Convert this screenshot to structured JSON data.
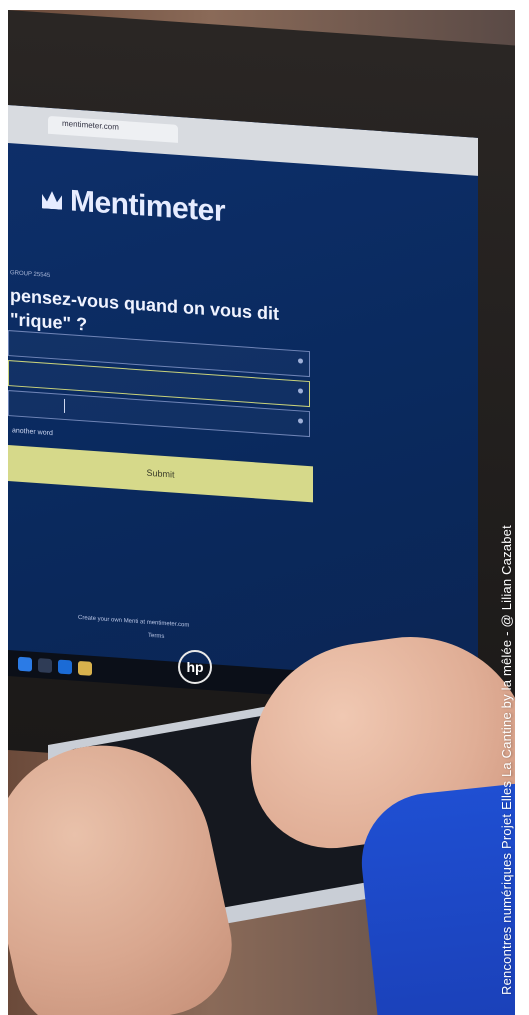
{
  "photo": {
    "browser_tab_label": "mentimeter.com",
    "app_name": "Mentimeter",
    "question_tag": "GROUP 25545",
    "question_text": "pensez-vous quand on vous dit\n\"rique\" ?",
    "input_placeholder": "",
    "add_another_label": "another word",
    "submit_label": "Submit",
    "footer_line_1": "Create your own Menti at mentimeter.com",
    "footer_line_2": "Terms",
    "brand_logo": "hp"
  },
  "credit": {
    "text": "Rencontres numériques Projet Elles La Cantine by la mêlée - @ Lilian Cazabet"
  }
}
